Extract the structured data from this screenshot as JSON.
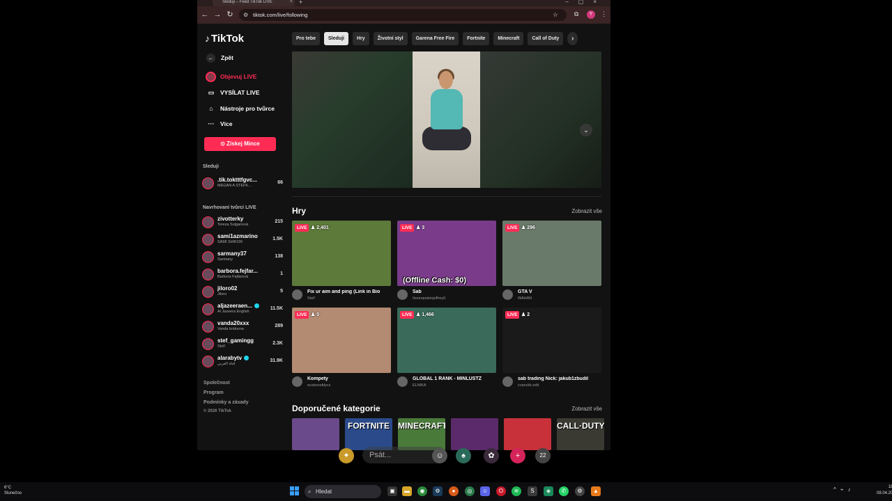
{
  "browser": {
    "tab_title": "Sleduji – Feed TikTok LIVE",
    "url": "tiktok.com/live/following",
    "profile_initial": "Y"
  },
  "sidebar": {
    "logo": "TikTok",
    "back_label": "Zpět",
    "nav": [
      {
        "label": "Objevuj LIVE",
        "icon": "live-icon"
      },
      {
        "label": "VYSÍLAT LIVE",
        "icon": "camera-icon"
      },
      {
        "label": "Nástroje pro tvůrce",
        "icon": "home-icon"
      },
      {
        "label": "Více",
        "icon": "more-icon"
      }
    ],
    "coins_button": "Získej Mince",
    "following_heading": "Sleduji",
    "following": [
      {
        "name": ".tik.toktttfgvc...",
        "sub": "MEGAN A ŠTEFK...",
        "count": "66"
      }
    ],
    "suggested_heading": "Navrhovaní tvůrci LIVE",
    "suggested": [
      {
        "name": "zivotterky",
        "sub": "Tereza Šulganová",
        "count": "215",
        "verified": false
      },
      {
        "name": "sami1azmarino",
        "sub": "SAMI SHIKOR",
        "count": "1.5K",
        "verified": false
      },
      {
        "name": "sarmany37",
        "sub": "Sarmany",
        "count": "138",
        "verified": false
      },
      {
        "name": "barbora.fejfar...",
        "sub": "Barbora Fejfarová",
        "count": "1",
        "verified": false
      },
      {
        "name": "jiloro02",
        "sub": "Jiloro",
        "count": "5",
        "verified": false
      },
      {
        "name": "aljazeeraen...",
        "sub": "Al Jazeera English",
        "count": "11.5K",
        "verified": true
      },
      {
        "name": "vanda20xxx",
        "sub": "Vanda královna",
        "count": "289",
        "verified": false
      },
      {
        "name": "stef_gamingg",
        "sub": "SteF",
        "count": "2.3K",
        "verified": false
      },
      {
        "name": "alarabytv",
        "sub": "قناة العربي",
        "count": "31.9K",
        "verified": true
      }
    ],
    "footer": [
      "Společnost",
      "Program",
      "Podmínky a zásady"
    ],
    "copyright": "© 2026 TikTok"
  },
  "chips": [
    "Pro tebe",
    "Sleduji",
    "Hry",
    "Životní styl",
    "Garena Free Fire",
    "Fortnite",
    "Minecraft",
    "Call of Duty"
  ],
  "chips_selected": "Sleduji",
  "games": {
    "title": "Hry",
    "see_all": "Zobrazit vše",
    "live_badge": "LIVE",
    "cards": [
      {
        "viewers": "2,401",
        "title": "Fix ur aim and ping (Link in Bio",
        "user": "SteF",
        "thumb_color": "#5d7a3a"
      },
      {
        "viewers": "3",
        "title": "Sab",
        "user": "Itsveepsteinjeffrey0",
        "thumb_color": "#7a3c8a",
        "overlay": "(Offline Cash: $0)"
      },
      {
        "viewers": "296",
        "title": "GTA V",
        "user": "WAHAN",
        "thumb_color": "#6a7a6a"
      },
      {
        "viewers": "0",
        "title": "Kompety",
        "user": "ecstezoddycz",
        "thumb_color": "#b38a72"
      },
      {
        "viewers": "1,466",
        "title": "GLOBAL 1 RANK - MINLUSTZ",
        "user": "ELNIKA",
        "thumb_color": "#3a6a5a"
      },
      {
        "viewers": "2",
        "title": "sab trading Nick: jakub1zbudil",
        "user": "cvanckk.edit",
        "thumb_color": "#1a1a1a"
      }
    ]
  },
  "categories": {
    "title": "Doporučené kategorie",
    "see_all": "Zobrazit vše",
    "items": [
      {
        "label": "",
        "color": "#6a4a8a"
      },
      {
        "label": "FORTNITE",
        "color": "#2a4a8a"
      },
      {
        "label": "MINECRAFT",
        "color": "#4a7a3a"
      },
      {
        "label": "",
        "color": "#5a2a6a"
      },
      {
        "label": "",
        "color": "#c8303a"
      },
      {
        "label": "CALL·DUTY",
        "color": "#3a3a32"
      }
    ]
  },
  "chat": {
    "placeholder": "Psát...",
    "count": "22"
  },
  "taskbar": {
    "temp": "6°C",
    "weather": "Slunečno",
    "search": "Hledat",
    "time": "18",
    "date": "08.04.20"
  }
}
